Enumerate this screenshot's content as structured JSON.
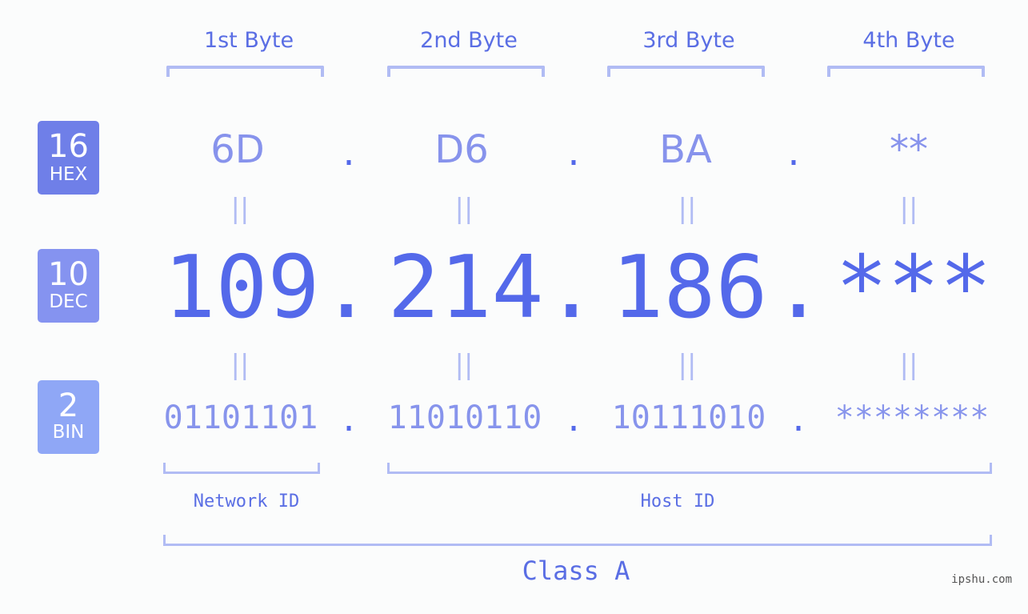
{
  "badges": [
    {
      "num": "16",
      "label": "HEX",
      "color": "#6f7fe8"
    },
    {
      "num": "10",
      "label": "DEC",
      "color": "#8593f0"
    },
    {
      "num": "2",
      "label": "BIN",
      "color": "#8fa7f6"
    }
  ],
  "byte_titles": [
    "1st Byte",
    "2nd Byte",
    "3rd Byte",
    "4th Byte"
  ],
  "hex": [
    "6D",
    "D6",
    "BA",
    "**"
  ],
  "dec": [
    "109",
    "214",
    "186",
    "***"
  ],
  "bin": [
    "01101101",
    "11010110",
    "10111010",
    "********"
  ],
  "separator": ".",
  "equals": "||",
  "network_id_label": "Network ID",
  "host_id_label": "Host ID",
  "class_label": "Class A",
  "watermark": "ipshu.com",
  "colors": {
    "accent": "#5469ea",
    "light": "#8793ec",
    "bracket": "#b1bcf4"
  }
}
